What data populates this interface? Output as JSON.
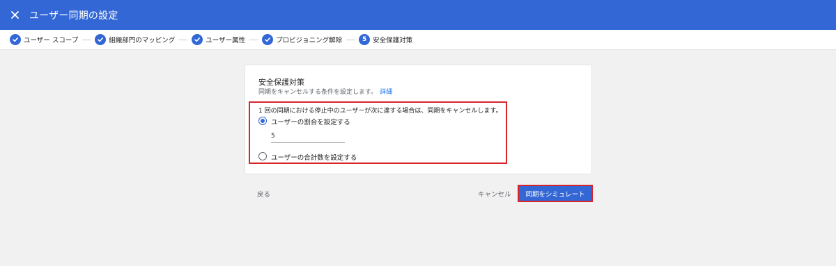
{
  "header": {
    "title": "ユーザー同期の設定",
    "close_icon": "close-icon",
    "background_color": "#3367d6"
  },
  "stepper": {
    "steps": [
      {
        "label": "ユーザー スコープ",
        "status": "done",
        "icon": "check-icon"
      },
      {
        "label": "組織部門のマッピング",
        "status": "done",
        "icon": "check-icon"
      },
      {
        "label": "ユーザー属性",
        "status": "done",
        "icon": "check-icon"
      },
      {
        "label": "プロビジョニング解除",
        "status": "done",
        "icon": "check-icon"
      },
      {
        "label": "安全保護対策",
        "status": "current",
        "number": "5"
      }
    ]
  },
  "card": {
    "heading": "安全保護対策",
    "description": "同期をキャンセルする条件を設定します。",
    "details_link": "詳細",
    "condition_text": "1 回の同期における停止中のユーザーが次に達する場合は、同期をキャンセルします。",
    "options": [
      {
        "label": "ユーザーの割合を設定する",
        "checked": true
      },
      {
        "label": "ユーザーの合計数を設定する",
        "checked": false
      }
    ],
    "value": "5"
  },
  "footer": {
    "back_label": "戻る",
    "cancel_label": "キャンセル",
    "simulate_label": "同期をシミュレート"
  },
  "colors": {
    "accent": "#3367d6",
    "highlight": "#d8232a"
  }
}
